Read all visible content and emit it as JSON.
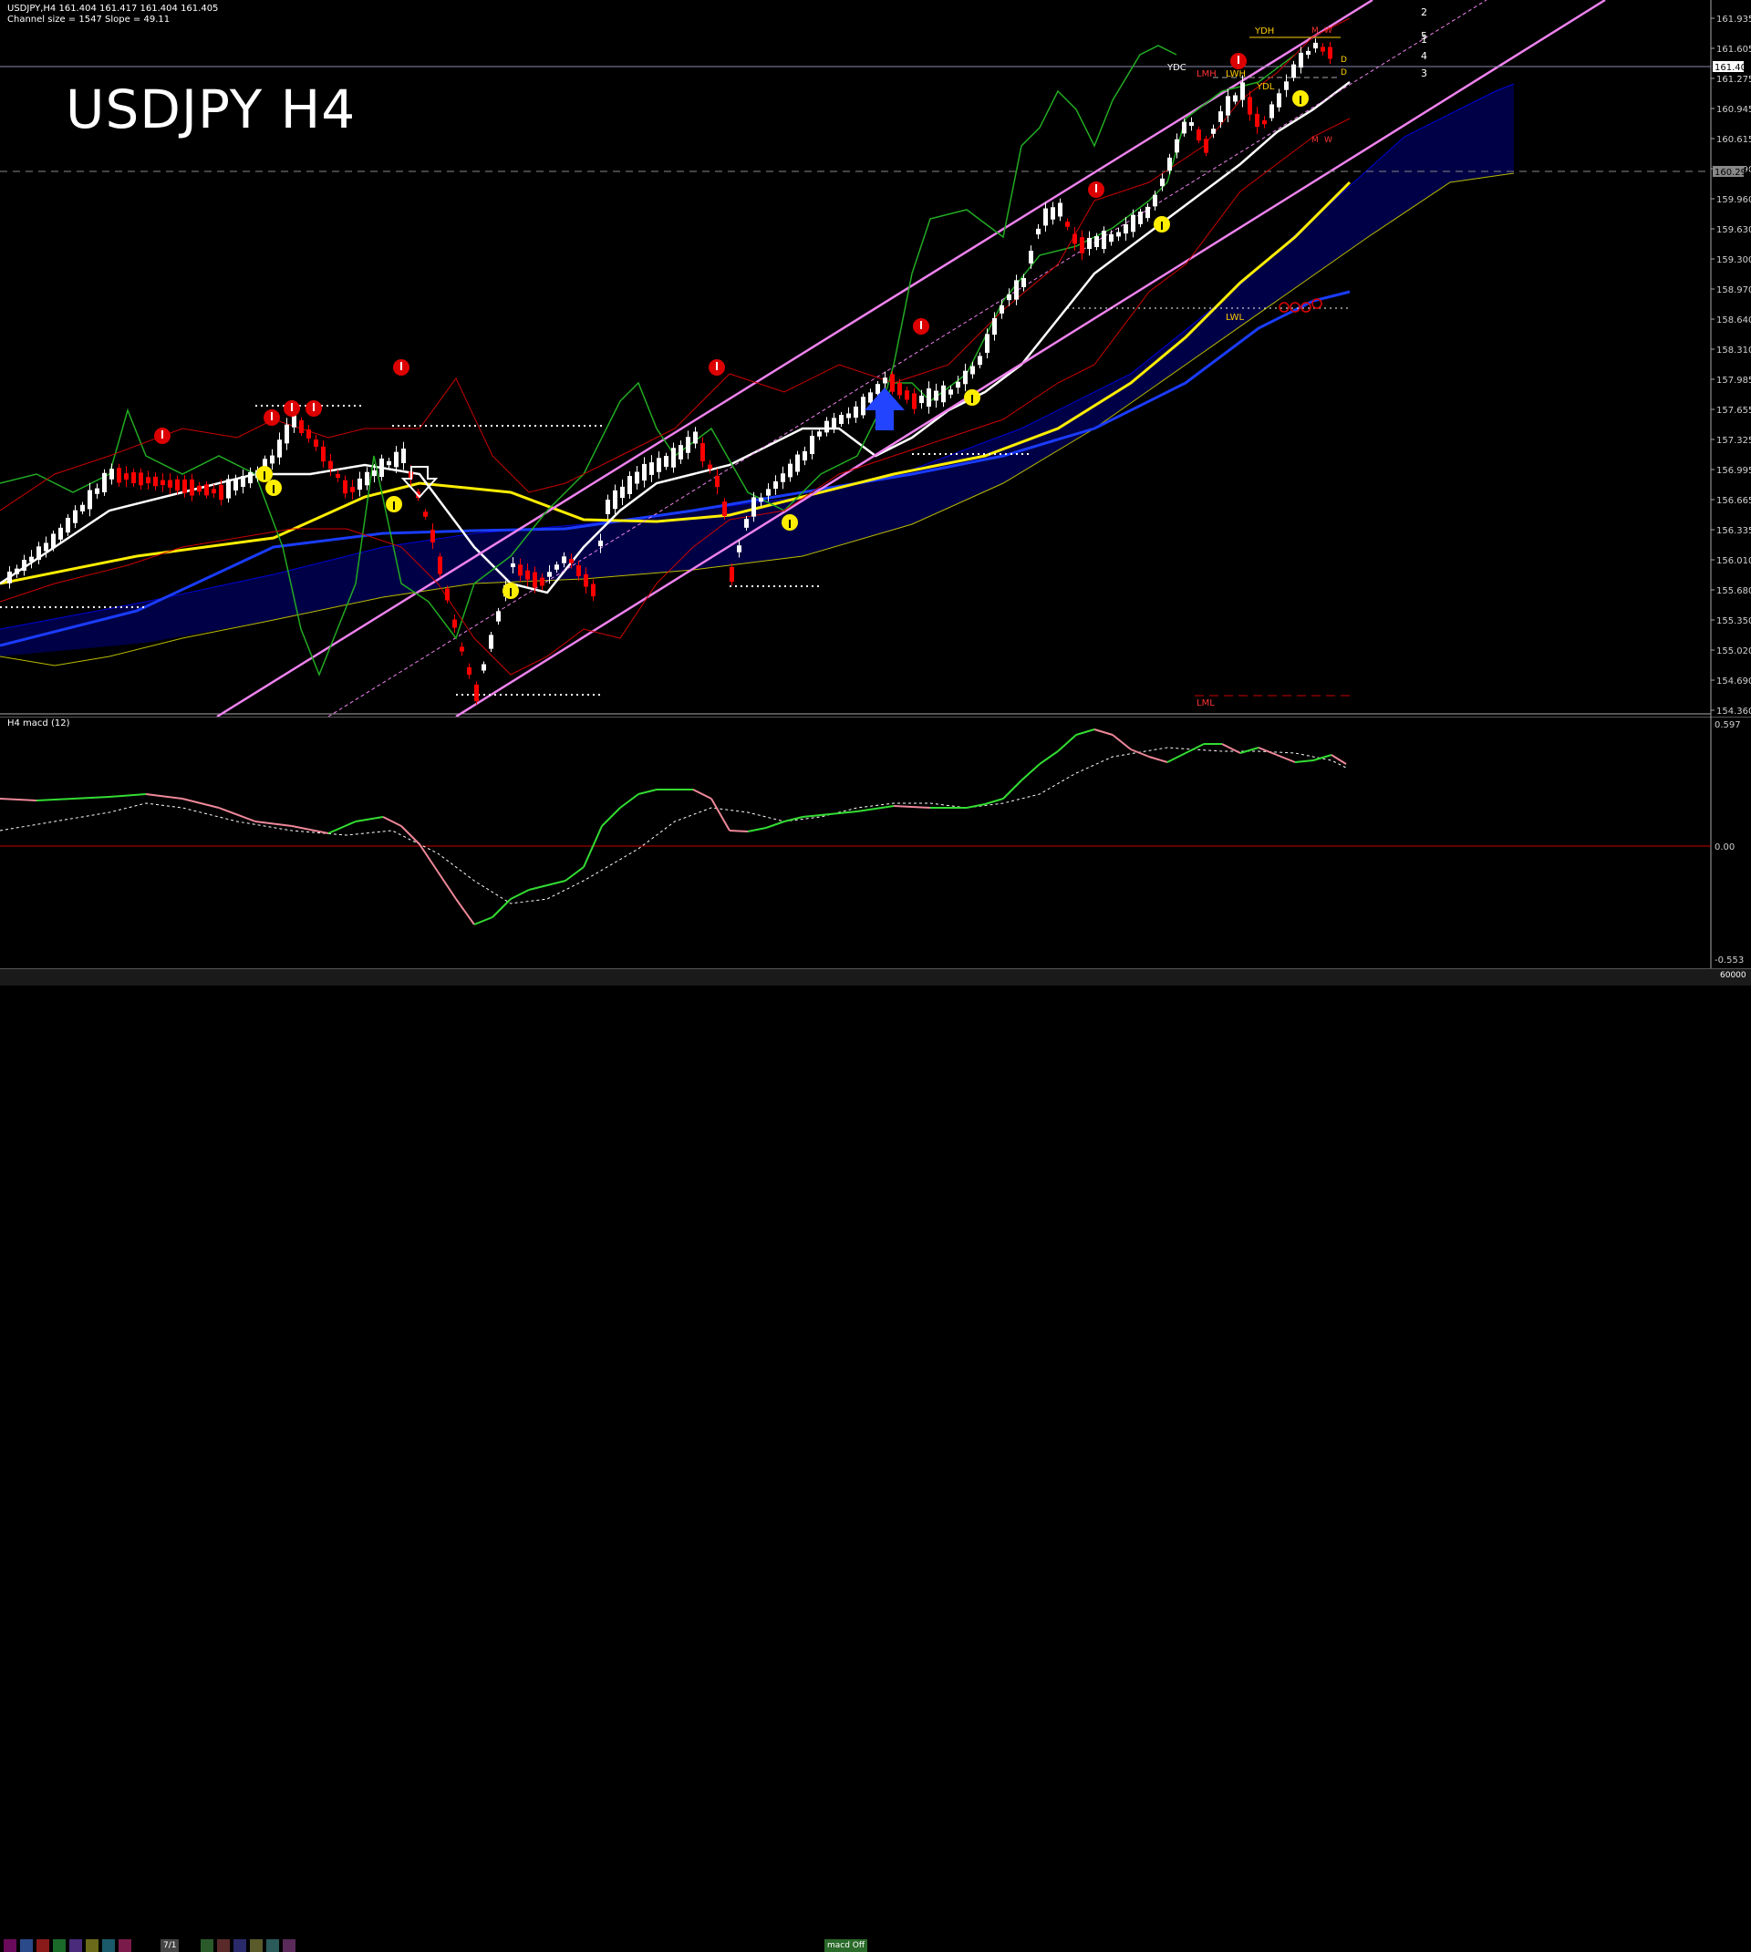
{
  "chart": {
    "symbol_header": "USDJPY,H4  161.404 161.417 161.404 161.405",
    "channel_info": "Channel size = 1547 Slope = 49.11",
    "overlay_title": "USDJPY H4"
  },
  "price_axis": {
    "labels": [
      "161.935",
      "161.605",
      "161.275",
      "160.945",
      "160.615",
      "160.290",
      "159.960",
      "159.630",
      "159.300",
      "158.970",
      "158.640",
      "158.310",
      "157.985",
      "157.655",
      "157.325",
      "156.995",
      "156.665",
      "156.335",
      "156.010",
      "155.680",
      "155.350",
      "155.020",
      "154.690",
      "154.360"
    ],
    "current_price": "161.405",
    "marked_level": "160.290"
  },
  "channel_labels": [
    "2",
    "5",
    "1",
    "4",
    "3"
  ],
  "level_tags": {
    "ydh": "YDH",
    "ydc": "YDC",
    "ydl": "YDL",
    "lmh": "LMH",
    "lwh": "LWH",
    "lwl": "LWL",
    "lml": "LML",
    "m": "M",
    "w": "W",
    "d": "D"
  },
  "macd": {
    "header": "H4  macd (12)",
    "axis_labels": [
      "0.597",
      "0.00",
      "-0.553"
    ]
  },
  "bottom": {
    "tab_date": "7/1",
    "tab_macd": "macd Off",
    "right_value": "60000"
  },
  "colors": {
    "bull_candle": "#ffffff",
    "bear_candle": "#ff0000",
    "channel": "#ee82ee",
    "kumo": "#0000cc",
    "macd_up": "#33dd33",
    "macd_down": "#ee8899",
    "zero_line": "#cc0000"
  }
}
